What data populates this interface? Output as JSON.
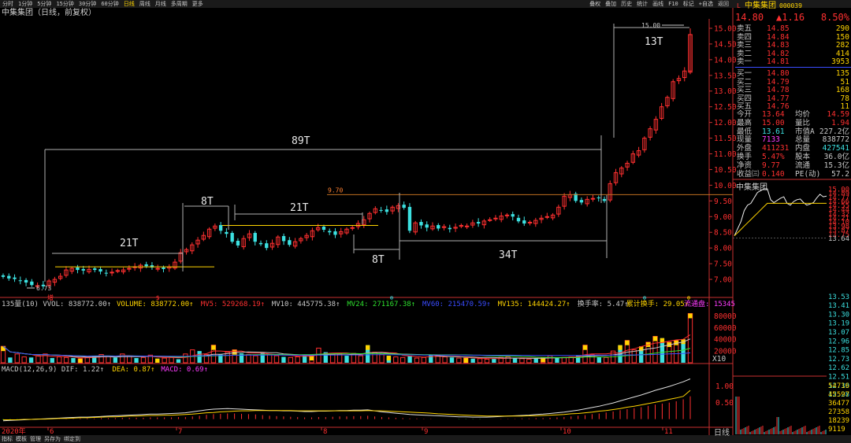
{
  "toolbar": {
    "left": [
      "分时",
      "1分钟",
      "5分钟",
      "15分钟",
      "30分钟",
      "60分钟",
      "日线",
      "周线",
      "月线",
      "多周期",
      "更多"
    ],
    "active": "日线",
    "right": [
      "叠权",
      "叠加",
      "历史",
      "统计",
      "画线",
      "F10",
      "标记",
      "+自选",
      "返回"
    ]
  },
  "title": "中集集团（日线，前复权）",
  "stock": {
    "name": "中集集团",
    "code": "000039",
    "flag": "L",
    "price": "14.80",
    "change": "▲1.16",
    "pct": "8.50%"
  },
  "orderbook": {
    "sell": [
      {
        "label": "卖五",
        "price": "14.85",
        "vol": "290"
      },
      {
        "label": "卖四",
        "price": "14.84",
        "vol": "150"
      },
      {
        "label": "卖三",
        "price": "14.83",
        "vol": "282"
      },
      {
        "label": "卖二",
        "price": "14.82",
        "vol": "414"
      },
      {
        "label": "卖一",
        "price": "14.81",
        "vol": "3953"
      }
    ],
    "buy": [
      {
        "label": "买一",
        "price": "14.80",
        "vol": "135"
      },
      {
        "label": "买二",
        "price": "14.79",
        "vol": "51"
      },
      {
        "label": "买三",
        "price": "14.78",
        "vol": "168"
      },
      {
        "label": "买四",
        "price": "14.77",
        "vol": "78"
      },
      {
        "label": "买五",
        "price": "14.76",
        "vol": "11"
      }
    ]
  },
  "stats": [
    {
      "k1": "今开",
      "v1": "13.64",
      "k2": "均价",
      "v2": "14.59"
    },
    {
      "k1": "最高",
      "v1": "15.00",
      "k2": "量比",
      "v2": "1.94"
    },
    {
      "k1": "最低",
      "v1": "13.61",
      "k2": "市值A",
      "v2": "227.2亿"
    },
    {
      "k1": "现量",
      "v1": "7133",
      "k2": "总量",
      "v2": "838772"
    },
    {
      "k1": "外盘",
      "v1": "411231",
      "k2": "内盘",
      "v2": "427541"
    },
    {
      "k1": "换手",
      "v1": "5.47%",
      "k2": "股本",
      "v2": "36.0亿"
    },
    {
      "k1": "净资",
      "v1": "9.77",
      "k2": "流通",
      "v2": "15.3亿"
    },
    {
      "k1": "收益㈢",
      "v1": "0.140",
      "k2": "PE(动)",
      "v2": "57.2"
    }
  ],
  "intraday_title": "中集集团",
  "intraday_price_ticks": [
    "15.00",
    "14.89",
    "14.77",
    "14.66",
    "14.55",
    "14.44",
    "14.32",
    "14.21",
    "14.10",
    "13.98",
    "13.87",
    "13.75",
    "13.64",
    "13.53",
    "13.41",
    "13.30",
    "13.19",
    "13.07",
    "12.96",
    "12.85",
    "12.73",
    "12.62",
    "12.51",
    "12.39",
    "12.28"
  ],
  "intraday_vol_ticks": [
    "54716",
    "45597",
    "36477",
    "27358",
    "18239",
    "9119"
  ],
  "bottom_tabs": [
    "指标",
    "模板",
    "管理",
    "另存为",
    "绑定到"
  ],
  "bottom_right": "日线",
  "indicators": {
    "vol": [
      {
        "text": "135量(10) VVOL: 838772.00↑",
        "color": "#c8c8c8"
      },
      {
        "text": "VOLUME: 838772.00↑",
        "color": "#ffd400"
      },
      {
        "text": "MV5: 529268.19↑",
        "color": "#ff3030"
      },
      {
        "text": "MV10: 445775.38↑",
        "color": "#c8c8c8"
      },
      {
        "text": "MV24: 271167.38↑",
        "color": "#2ee02e"
      },
      {
        "text": "MV60: 215470.59↑",
        "color": "#3a4cff"
      },
      {
        "text": "MV135: 144424.27↑",
        "color": "#ffd400"
      },
      {
        "text": "换手率: 5.47↑",
        "color": "#c8c8c8"
      },
      {
        "text": "累计换手: 29.05↑",
        "color": "#ffd400"
      },
      {
        "text": "流通盘: 15345",
        "color": "#ff3cff"
      }
    ],
    "macd": [
      {
        "text": "MACD(12,26,9) DIF: 1.22↑",
        "color": "#c8c8c8"
      },
      {
        "text": "DEA: 0.87↑",
        "color": "#ffd400"
      },
      {
        "text": "MACD: 0.69↑",
        "color": "#ff3cff"
      }
    ]
  },
  "annotations": [
    {
      "text": "89T"
    },
    {
      "text": "21T"
    },
    {
      "text": "8T"
    },
    {
      "text": "21T"
    },
    {
      "text": "8T"
    },
    {
      "text": "34T"
    },
    {
      "text": "13T"
    }
  ],
  "colors": {
    "up": "#ff3030",
    "down": "#3ce0e0",
    "grid": "#8a1010",
    "axis": "#c83030",
    "ma5": "#ff3030",
    "ma10": "#c8c8c8",
    "ma24": "#2ee02e",
    "ma60": "#3a4cff",
    "ma135": "#ffd400"
  },
  "chart_data": {
    "type": "candlestick",
    "price_axis_ticks": [
      "15.00",
      "14.50",
      "14.00",
      "13.50",
      "13.00",
      "12.50",
      "12.00",
      "11.50",
      "11.00",
      "10.50",
      "10.00",
      "9.50",
      "9.00",
      "8.50",
      "8.00",
      "7.50",
      "7.00"
    ],
    "price_ylim": [
      6.5,
      15.3
    ],
    "month_labels": [
      "2020年",
      "6",
      "7",
      "8",
      "9",
      "10",
      "11"
    ],
    "price_labels": [
      "15.00",
      "9.70",
      "6.73"
    ],
    "vol_axis_ticks": [
      "80000",
      "60000",
      "40000",
      "20000",
      "X10"
    ],
    "vol_ylim": [
      0,
      90000
    ],
    "macd_axis_ticks": [
      "1.00",
      "0.50"
    ],
    "macd_ylim": [
      -0.2,
      1.35
    ],
    "horizontal_levels": [
      9.7
    ],
    "volume": [
      28000,
      9000,
      15000,
      10000,
      9000,
      12000,
      15000,
      8000,
      10000,
      9000,
      8000,
      7000,
      9000,
      12000,
      14000,
      11000,
      9000,
      15000,
      12000,
      8000,
      9000,
      13000,
      7000,
      8000,
      9000,
      6000,
      15000,
      22000,
      20000,
      14000,
      30000,
      14000,
      18000,
      22000,
      16000,
      14000,
      12000,
      18000,
      14000,
      12000,
      10000,
      9000,
      10000,
      14000,
      12000,
      25000,
      18000,
      14000,
      15000,
      12000,
      16000,
      12000,
      30000,
      18000,
      14000,
      12000,
      10000,
      9000,
      12000,
      8000,
      9000,
      14000,
      12000,
      10000,
      9000,
      8000,
      8000,
      7000,
      7000,
      6000,
      7000,
      9000,
      10000,
      8000,
      7000,
      6000,
      8000,
      9000,
      12000,
      8000,
      9000,
      10000,
      12000,
      30000,
      14000,
      10000,
      9000,
      20000,
      30000,
      38000,
      22000,
      28000,
      35000,
      45000,
      42000,
      35000,
      38000,
      40000,
      84000
    ],
    "macd_hist": [
      -0.03,
      -0.02,
      -0.02,
      -0.02,
      -0.01,
      -0.01,
      0.0,
      0.0,
      0.01,
      0.01,
      0.01,
      0.02,
      0.02,
      0.02,
      0.03,
      0.03,
      0.03,
      0.04,
      0.04,
      0.04,
      0.04,
      0.05,
      0.05,
      0.05,
      0.05,
      0.06,
      0.06,
      0.08,
      0.1,
      0.13,
      0.15,
      0.16,
      0.17,
      0.17,
      0.16,
      0.15,
      0.14,
      0.12,
      0.1,
      0.09,
      0.08,
      0.07,
      0.06,
      0.05,
      0.05,
      0.06,
      0.06,
      0.07,
      0.08,
      0.08,
      0.09,
      0.09,
      0.1,
      0.08,
      0.06,
      0.05,
      0.04,
      0.03,
      0.02,
      0.02,
      0.01,
      0.01,
      0.0,
      0.0,
      0.0,
      -0.01,
      -0.01,
      -0.01,
      -0.01,
      0.0,
      0.0,
      0.01,
      0.01,
      0.01,
      0.02,
      0.02,
      0.03,
      0.03,
      0.04,
      0.05,
      0.06,
      0.08,
      0.1,
      0.12,
      0.15,
      0.17,
      0.2,
      0.23,
      0.27,
      0.3,
      0.33,
      0.36,
      0.4,
      0.44,
      0.47,
      0.5,
      0.54,
      0.6,
      0.69
    ],
    "dif": [
      -0.05,
      -0.04,
      -0.03,
      -0.02,
      -0.01,
      0.0,
      0.01,
      0.02,
      0.03,
      0.04,
      0.05,
      0.06,
      0.06,
      0.07,
      0.08,
      0.09,
      0.1,
      0.11,
      0.12,
      0.13,
      0.14,
      0.15,
      0.15,
      0.16,
      0.17,
      0.18,
      0.19,
      0.22,
      0.25,
      0.28,
      0.3,
      0.31,
      0.32,
      0.31,
      0.3,
      0.29,
      0.28,
      0.27,
      0.26,
      0.26,
      0.25,
      0.25,
      0.24,
      0.23,
      0.23,
      0.24,
      0.24,
      0.25,
      0.26,
      0.26,
      0.27,
      0.27,
      0.28,
      0.25,
      0.22,
      0.2,
      0.18,
      0.16,
      0.14,
      0.13,
      0.12,
      0.11,
      0.1,
      0.09,
      0.08,
      0.07,
      0.07,
      0.06,
      0.06,
      0.06,
      0.07,
      0.08,
      0.09,
      0.1,
      0.11,
      0.12,
      0.14,
      0.15,
      0.17,
      0.19,
      0.21,
      0.24,
      0.27,
      0.31,
      0.35,
      0.39,
      0.44,
      0.49,
      0.55,
      0.61,
      0.67,
      0.73,
      0.8,
      0.87,
      0.93,
      0.99,
      1.06,
      1.13,
      1.22
    ],
    "dea": [
      -0.02,
      -0.02,
      -0.02,
      -0.01,
      -0.01,
      0.0,
      0.0,
      0.01,
      0.02,
      0.02,
      0.03,
      0.04,
      0.04,
      0.05,
      0.06,
      0.07,
      0.07,
      0.08,
      0.09,
      0.09,
      0.1,
      0.11,
      0.11,
      0.12,
      0.12,
      0.13,
      0.14,
      0.15,
      0.17,
      0.19,
      0.2,
      0.22,
      0.23,
      0.24,
      0.25,
      0.25,
      0.26,
      0.26,
      0.26,
      0.26,
      0.26,
      0.26,
      0.25,
      0.25,
      0.25,
      0.25,
      0.25,
      0.25,
      0.25,
      0.25,
      0.25,
      0.25,
      0.26,
      0.25,
      0.25,
      0.24,
      0.23,
      0.22,
      0.21,
      0.2,
      0.19,
      0.18,
      0.16,
      0.15,
      0.14,
      0.13,
      0.12,
      0.11,
      0.1,
      0.09,
      0.09,
      0.09,
      0.09,
      0.09,
      0.09,
      0.1,
      0.1,
      0.11,
      0.12,
      0.13,
      0.14,
      0.16,
      0.17,
      0.19,
      0.21,
      0.24,
      0.26,
      0.29,
      0.32,
      0.36,
      0.39,
      0.43,
      0.47,
      0.51,
      0.55,
      0.6,
      0.64,
      0.69,
      0.87
    ]
  }
}
